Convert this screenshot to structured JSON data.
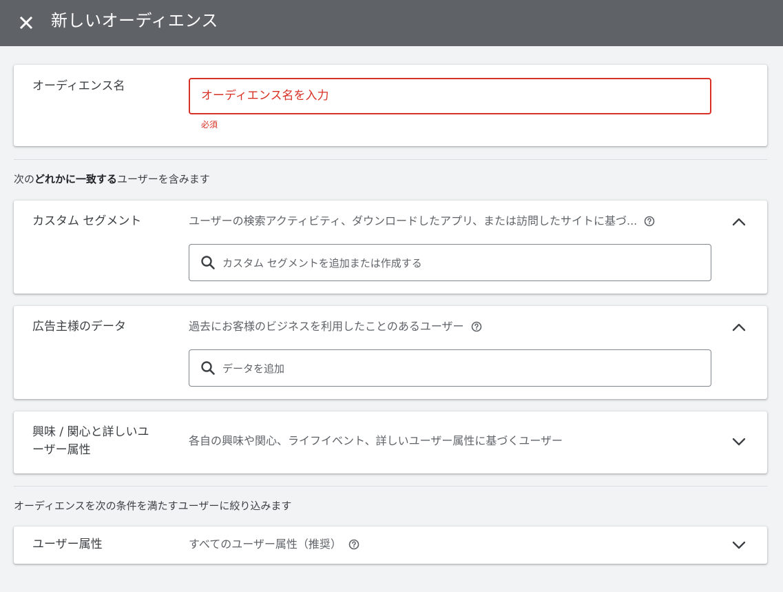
{
  "header": {
    "title": "新しいオーディエンス",
    "close_icon": "close-icon"
  },
  "audience_name": {
    "label": "オーディエンス名",
    "placeholder": "オーディエンス名を入力",
    "error_text": "必須"
  },
  "include_section": {
    "prefix": "次の",
    "emphasis": "どれかに一致する",
    "suffix": "ユーザーを含みます"
  },
  "custom_segments": {
    "label": "カスタム セグメント",
    "description": "ユーザーの検索アクティビティ、ダウンロードしたアプリ、または訪問したサイトに基づ...",
    "search_placeholder": "カスタム セグメントを追加または作成する",
    "expanded": true
  },
  "advertiser_data": {
    "label": "広告主様のデータ",
    "description": "過去にお客様のビジネスを利用したことのあるユーザー",
    "search_placeholder": "データを追加",
    "expanded": true
  },
  "interests": {
    "label_line1": "興味 / 関心と詳しいユ",
    "label_line2": "ーザー属性",
    "description": "各自の興味や関心、ライフイベント、詳しいユーザー属性に基づくユーザー",
    "expanded": false
  },
  "narrow_section": {
    "text": "オーディエンスを次の条件を満たすユーザーに絞り込みます"
  },
  "demographics": {
    "label": "ユーザー属性",
    "description": "すべてのユーザー属性（推奨）",
    "expanded": false
  },
  "colors": {
    "header_bg": "#5f6368",
    "page_bg": "#f1f3f4",
    "error": "#d93025"
  }
}
